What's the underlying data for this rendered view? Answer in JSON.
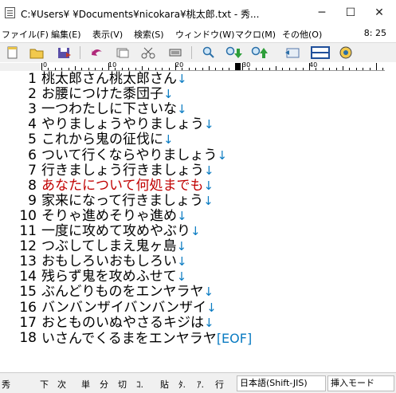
{
  "window": {
    "title": "C:¥Users¥           ¥Documents¥nicokara¥桃太郎.txt - 秀...",
    "minimize_glyph": "─",
    "maximize_glyph": "☐",
    "close_glyph": "✕"
  },
  "menu": {
    "items": [
      "ファイル(F)",
      "編集(E)",
      "表示(V)",
      "検索(S)",
      "ウィンドウ(W)",
      "マクロ(M)",
      "その他(O)"
    ],
    "cursor_position": "8: 25"
  },
  "toolbar": {
    "buttons": [
      "new-file-icon",
      "open-folder-icon",
      "save-icon",
      "undo-icon",
      "copy-icon",
      "cut-icon",
      "paste-icon",
      "find-icon",
      "find-next-icon",
      "find-prev-icon",
      "jump-icon",
      "split-window-icon",
      "help-icon"
    ]
  },
  "ruler": {
    "labels": [
      "0",
      "10",
      "20",
      "30",
      "40"
    ]
  },
  "editor": {
    "lines": [
      {
        "num": "1",
        "text": "桃太郎さん桃太郎さん",
        "end": "↓"
      },
      {
        "num": "2",
        "text": "お腰につけた黍団子",
        "end": "↓"
      },
      {
        "num": "3",
        "text": "一つわたしに下さいな",
        "end": "↓"
      },
      {
        "num": "4",
        "text": "やりましょうやりましょう",
        "end": "↓"
      },
      {
        "num": "5",
        "text": "これから鬼の征伐に",
        "end": "↓"
      },
      {
        "num": "6",
        "text": "ついて行くならやりましょう",
        "end": "↓"
      },
      {
        "num": "7",
        "text": "行きましょう行きましょう",
        "end": "↓"
      },
      {
        "num": "8",
        "text": "あなたについて何処までも",
        "end": "↓"
      },
      {
        "num": "9",
        "text": "家来になって行きましょう",
        "end": "↓"
      },
      {
        "num": "10",
        "text": "そりゃ進めそりゃ進め",
        "end": "↓"
      },
      {
        "num": "11",
        "text": "一度に攻めて攻めやぶり",
        "end": "↓"
      },
      {
        "num": "12",
        "text": "つぶしてしまえ鬼ヶ島",
        "end": "↓"
      },
      {
        "num": "13",
        "text": "おもしろいおもしろい",
        "end": "↓"
      },
      {
        "num": "14",
        "text": "残らず鬼を攻めふせて",
        "end": "↓"
      },
      {
        "num": "15",
        "text": "ぶんどりものをエンヤラヤ",
        "end": "↓"
      },
      {
        "num": "16",
        "text": "バンバンザイバンバンザイ",
        "end": "↓"
      },
      {
        "num": "17",
        "text": "おとものいぬやさるキジは",
        "end": "↓"
      },
      {
        "num": "18",
        "text": "いさんでくるまをエンヤラヤ",
        "end": "[EOF]"
      }
    ],
    "highlight_line": "8",
    "accent_color": "#0a7bc2",
    "current_line_color": "#c00000"
  },
  "status": {
    "fkeys": [
      "秀",
      "下",
      "次",
      "単",
      "分",
      "切",
      "ｺ.",
      "貼",
      "ﾀ.",
      "ｱ.",
      "行"
    ],
    "encoding": "日本語(Shift-JIS)",
    "mode": "挿入モード"
  }
}
